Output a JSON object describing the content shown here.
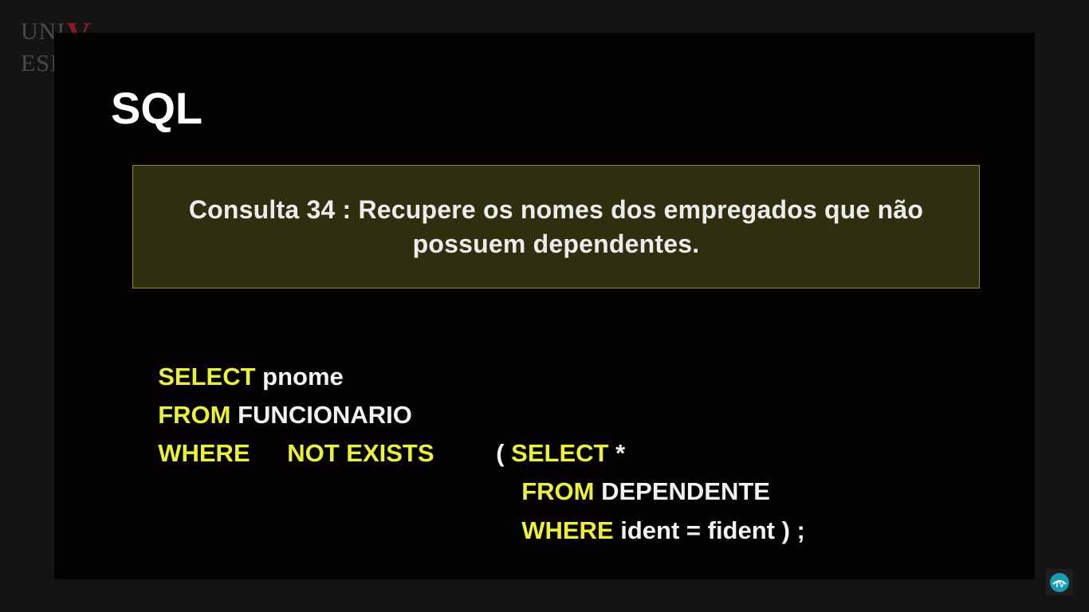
{
  "logo": {
    "text_left": "UNI",
    "text_v": "V",
    "text_right": "ESP"
  },
  "slide": {
    "title": "SQL",
    "question_line1": "Consulta 34 : Recupere os nomes dos empregados que não",
    "question_line2": "possuem dependentes."
  },
  "sql": {
    "line1": {
      "keyword": "SELECT",
      "rest": " pnome"
    },
    "line2": {
      "keyword": "FROM",
      "rest": " FUNCIONARIO"
    },
    "line3": {
      "keyword": "WHERE",
      "keyword2": "NOT EXISTS",
      "paren": "( ",
      "keyword3": "SELECT",
      "rest": " *"
    },
    "line4": {
      "keyword": "FROM",
      "rest": " DEPENDENTE"
    },
    "line5": {
      "keyword": "WHERE",
      "rest": " ident = fident ) ;"
    }
  },
  "colors": {
    "keyword": "#ecf03a",
    "box_fill": "#2f2f10",
    "box_border": "#8a8a36",
    "logo_accent": "#8a1a22"
  },
  "icons": {
    "tv_badge": "tv-logo-icon"
  }
}
